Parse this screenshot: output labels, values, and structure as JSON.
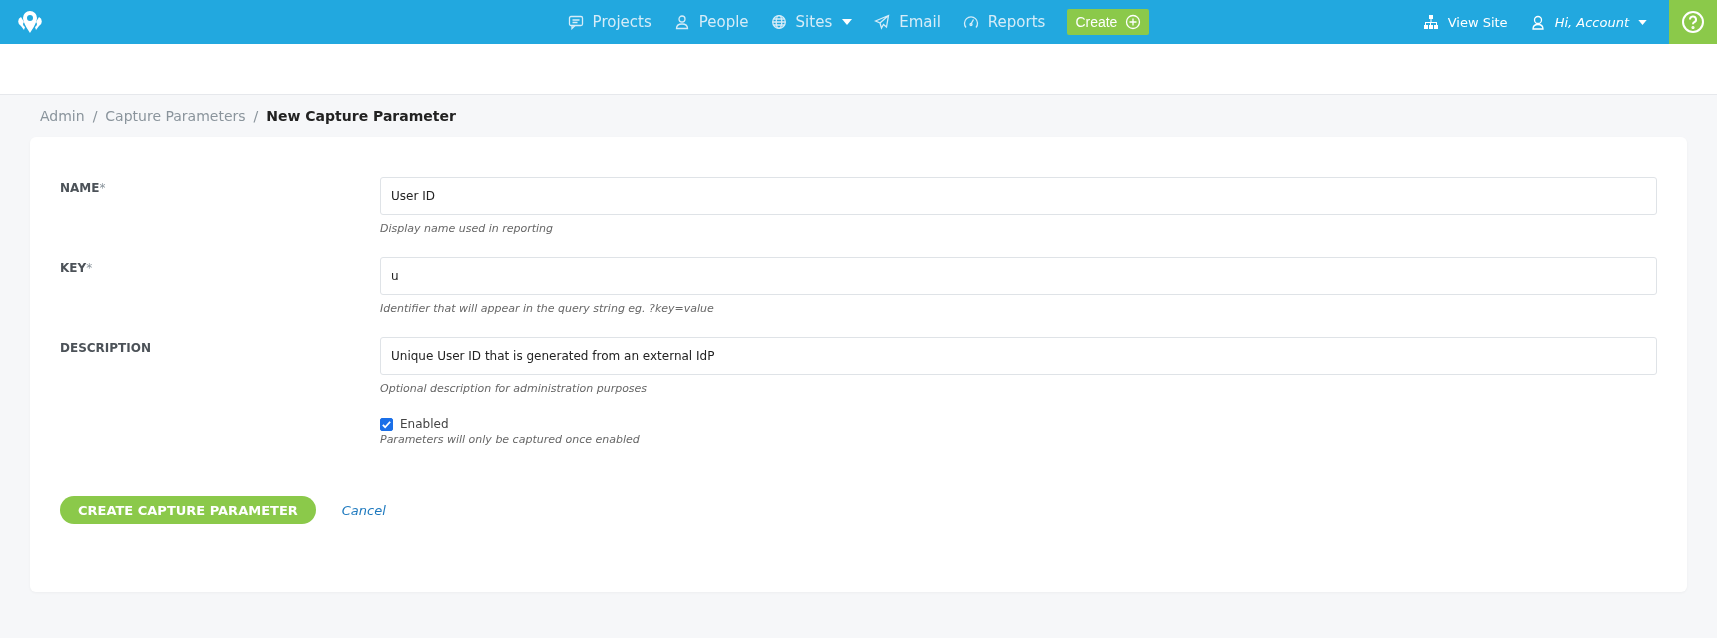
{
  "nav": {
    "items": [
      {
        "label": "Projects",
        "dropdown": false
      },
      {
        "label": "People",
        "dropdown": false
      },
      {
        "label": "Sites",
        "dropdown": true
      },
      {
        "label": "Email",
        "dropdown": false
      },
      {
        "label": "Reports",
        "dropdown": false
      }
    ],
    "create": "Create",
    "view_site": "View Site",
    "account": "Hi, Account"
  },
  "breadcrumb": [
    {
      "label": "Admin",
      "current": false
    },
    {
      "separator": "/",
      "label": "Capture Parameters",
      "current": false
    },
    {
      "separator": "/",
      "label": "New Capture Parameter",
      "current": true
    }
  ],
  "fields": [
    {
      "label": "NAME",
      "mark": "*",
      "value": "User ID",
      "help": "Display name used in reporting"
    },
    {
      "label": "KEY",
      "mark": "*",
      "value": "u",
      "help": "Identifier that will appear in the query string eg. ?key=value"
    },
    {
      "label": "DESCRIPTION",
      "value": "Unique User ID that is generated from an external IdP",
      "help": "Optional description for administration purposes"
    }
  ],
  "checkbox": {
    "label": "Enabled",
    "checked": true,
    "help": "Parameters will only be captured once enabled"
  },
  "actions": {
    "submit": "CREATE CAPTURE PARAMETER",
    "cancel": "Cancel"
  }
}
